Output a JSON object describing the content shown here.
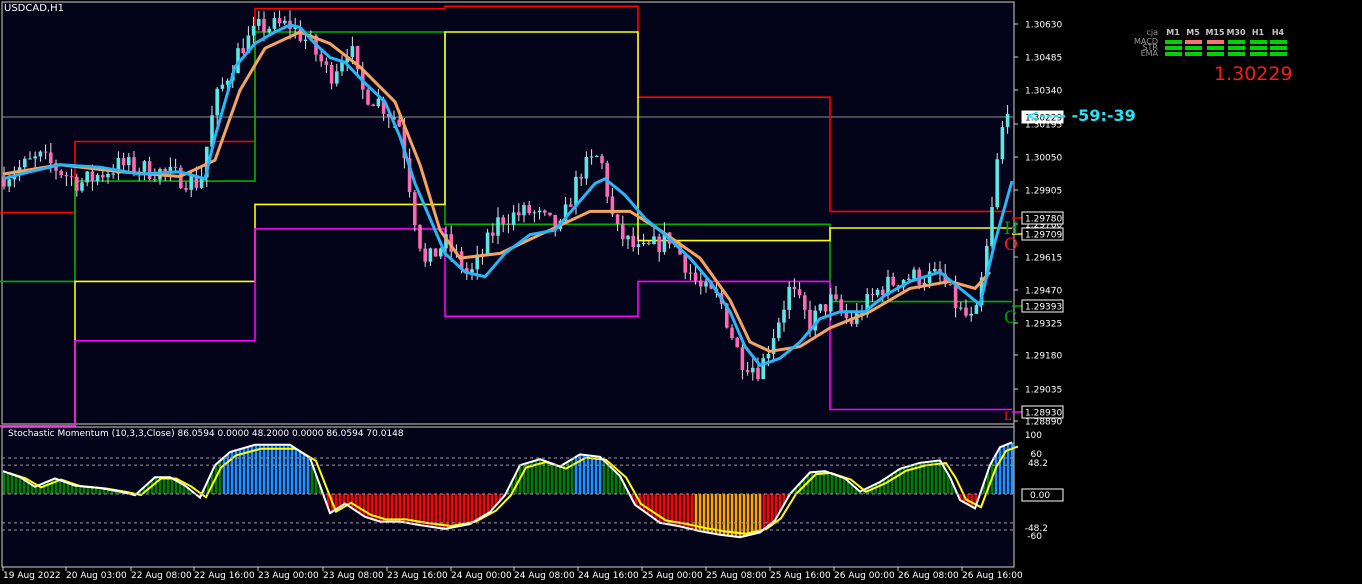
{
  "window": {
    "symbol_title": "USDCAD,H1"
  },
  "indicator": {
    "title": "Stochastic Momentum (10,3,3,Close) 86.0594 0.0000 48.2000 0.0000 86.0594 70.0148",
    "levels": [
      "100",
      "60",
      "48.2",
      "0.00",
      "-48.2",
      "-60"
    ],
    "zero_box": "0.00"
  },
  "signal_panel": {
    "pair_code": "cja",
    "timeframes": [
      "M1",
      "M5",
      "M15",
      "M30",
      "H1",
      "H4"
    ],
    "rows": [
      {
        "label": "MACD",
        "cells": [
          "#00d400",
          "#ff6f6f",
          "#ff6f6f",
          "#00d400",
          "#00d400",
          "#00d400"
        ]
      },
      {
        "label": "STR",
        "cells": [
          "#00d400",
          "#00d400",
          "#00d400",
          "#00d400",
          "#00d400",
          "#00d400"
        ]
      },
      {
        "label": "EMA",
        "cells": [
          "#00d400",
          "#00d400",
          "#00d400",
          "#00d400",
          "#00d400",
          "#00d400"
        ]
      }
    ]
  },
  "current_price": "1.30229",
  "countdown": "<---- -59:-39",
  "level_tags": {
    "high": "H",
    "open": "O",
    "close": "C",
    "low": "L"
  },
  "price_axis": {
    "ticks": [
      "1.30630",
      "1.30485",
      "1.30340",
      "1.30195",
      "1.30050",
      "1.29905",
      "1.29760",
      "1.29615",
      "1.29470",
      "1.29325",
      "1.29180",
      "1.29035",
      "1.28890"
    ],
    "boxes": [
      "1.30229",
      "1.29780",
      "1.29709",
      "1.29393",
      "1.28930"
    ]
  },
  "time_axis": {
    "labels": [
      "19 Aug 2022",
      "20 Aug 03:00",
      "22 Aug 08:00",
      "22 Aug 16:00",
      "23 Aug 00:00",
      "23 Aug 08:00",
      "23 Aug 16:00",
      "24 Aug 00:00",
      "24 Aug 08:00",
      "24 Aug 16:00",
      "25 Aug 00:00",
      "25 Aug 08:00",
      "25 Aug 16:00",
      "26 Aug 00:00",
      "26 Aug 08:00",
      "26 Aug 16:00"
    ]
  },
  "colors": {
    "background": "#000000",
    "chart_bg": "#03041a",
    "bull_candle": "#5ce6e6",
    "bear_candle": "#ff69b4",
    "fast_ma": "#29b6f6",
    "slow_ma": "#f4a460",
    "daily_high": "#ff0000",
    "daily_close": "#00b000",
    "daily_open": "#ffff00",
    "daily_low": "#ff00ff",
    "stoch_pos": "#008000",
    "stoch_neg": "#ff0000",
    "stoch_ext_pos": "#1e90ff",
    "stoch_ext_neg": "#ffa500",
    "stoch_main": "#ffffff",
    "stoch_signal": "#ffff00"
  },
  "chart_data": {
    "type": "candlestick",
    "price_range": [
      1.28868,
      1.3067
    ],
    "daily_levels": [
      {
        "from": 0,
        "to": 75,
        "high": 1.29775,
        "low": 1.2886,
        "open": 1.2886,
        "close": 1.2948
      },
      {
        "from": 75,
        "to": 255,
        "high": 1.3008,
        "low": 1.29225,
        "open": 1.2948,
        "close": 1.2991
      },
      {
        "from": 255,
        "to": 445,
        "high": 1.3065,
        "low": 1.29705,
        "open": 1.2981,
        "close": 1.3055
      },
      {
        "from": 445,
        "to": 638,
        "high": 1.3066,
        "low": 1.2933,
        "open": 1.3055,
        "close": 1.29725
      },
      {
        "from": 638,
        "to": 830,
        "high": 1.3027,
        "low": 1.2948,
        "open": 1.29655,
        "close": 1.29725
      },
      {
        "from": 830,
        "to": 1012,
        "high": 1.2978,
        "low": 1.2893,
        "open": 1.29709,
        "close": 1.29393
      }
    ],
    "close_path": [
      [
        3,
        1.2993
      ],
      [
        40,
        1.3001
      ],
      [
        80,
        1.299
      ],
      [
        120,
        1.2998
      ],
      [
        160,
        1.2995
      ],
      [
        200,
        1.299
      ],
      [
        215,
        1.3025
      ],
      [
        240,
        1.3048
      ],
      [
        260,
        1.3057
      ],
      [
        290,
        1.3058
      ],
      [
        310,
        1.305
      ],
      [
        330,
        1.3036
      ],
      [
        350,
        1.305
      ],
      [
        360,
        1.303
      ],
      [
        380,
        1.3025
      ],
      [
        400,
        1.3015
      ],
      [
        415,
        1.2975
      ],
      [
        425,
        1.2955
      ],
      [
        445,
        1.2965
      ],
      [
        470,
        1.295
      ],
      [
        500,
        1.2975
      ],
      [
        530,
        1.2978
      ],
      [
        560,
        1.297
      ],
      [
        580,
        1.2995
      ],
      [
        600,
        1.3002
      ],
      [
        615,
        1.297
      ],
      [
        640,
        1.296
      ],
      [
        670,
        1.2967
      ],
      [
        700,
        1.2945
      ],
      [
        720,
        1.294
      ],
      [
        740,
        1.2915
      ],
      [
        760,
        1.291
      ],
      [
        790,
        1.2945
      ],
      [
        810,
        1.293
      ],
      [
        830,
        1.294
      ],
      [
        850,
        1.293
      ],
      [
        880,
        1.2945
      ],
      [
        905,
        1.295
      ],
      [
        940,
        1.295
      ],
      [
        960,
        1.2935
      ],
      [
        975,
        1.293
      ],
      [
        990,
        1.297
      ],
      [
        1000,
        1.301
      ],
      [
        1010,
        1.30229
      ]
    ],
    "fast_ma": [
      [
        3,
        1.2992
      ],
      [
        30,
        1.2995
      ],
      [
        60,
        1.2998
      ],
      [
        100,
        1.2997
      ],
      [
        140,
        1.2994
      ],
      [
        180,
        1.2995
      ],
      [
        205,
        1.2992
      ],
      [
        215,
        1.301
      ],
      [
        235,
        1.304
      ],
      [
        255,
        1.305
      ],
      [
        275,
        1.3055
      ],
      [
        290,
        1.3058
      ],
      [
        300,
        1.3057
      ],
      [
        315,
        1.305
      ],
      [
        330,
        1.3044
      ],
      [
        345,
        1.3042
      ],
      [
        365,
        1.3033
      ],
      [
        385,
        1.3025
      ],
      [
        400,
        1.301
      ],
      [
        415,
        1.299
      ],
      [
        430,
        1.2975
      ],
      [
        445,
        1.296
      ],
      [
        465,
        1.2952
      ],
      [
        485,
        1.295
      ],
      [
        505,
        1.296
      ],
      [
        530,
        1.2968
      ],
      [
        555,
        1.297
      ],
      [
        575,
        1.298
      ],
      [
        595,
        1.299
      ],
      [
        605,
        1.2992
      ],
      [
        625,
        1.2985
      ],
      [
        645,
        1.2975
      ],
      [
        665,
        1.2968
      ],
      [
        690,
        1.2958
      ],
      [
        710,
        1.2948
      ],
      [
        730,
        1.2935
      ],
      [
        745,
        1.292
      ],
      [
        760,
        1.2912
      ],
      [
        780,
        1.2915
      ],
      [
        800,
        1.2922
      ],
      [
        820,
        1.2932
      ],
      [
        840,
        1.2935
      ],
      [
        865,
        1.2935
      ],
      [
        885,
        1.2942
      ],
      [
        910,
        1.2948
      ],
      [
        940,
        1.2952
      ],
      [
        960,
        1.2945
      ],
      [
        980,
        1.2938
      ],
      [
        995,
        1.2965
      ],
      [
        1012,
        1.2991
      ]
    ],
    "slow_ma": [
      [
        3,
        1.2994
      ],
      [
        60,
        1.2998
      ],
      [
        120,
        1.2995
      ],
      [
        180,
        1.2993
      ],
      [
        215,
        1.3
      ],
      [
        240,
        1.303
      ],
      [
        265,
        1.3048
      ],
      [
        300,
        1.3055
      ],
      [
        330,
        1.305
      ],
      [
        360,
        1.304
      ],
      [
        395,
        1.3025
      ],
      [
        420,
        1.2998
      ],
      [
        440,
        1.297
      ],
      [
        460,
        1.2958
      ],
      [
        500,
        1.296
      ],
      [
        540,
        1.2968
      ],
      [
        590,
        1.2978
      ],
      [
        630,
        1.2978
      ],
      [
        660,
        1.297
      ],
      [
        700,
        1.2958
      ],
      [
        730,
        1.294
      ],
      [
        750,
        1.2922
      ],
      [
        770,
        1.2918
      ],
      [
        800,
        1.292
      ],
      [
        830,
        1.2928
      ],
      [
        870,
        1.2935
      ],
      [
        910,
        1.2945
      ],
      [
        950,
        1.2948
      ],
      [
        975,
        1.2945
      ],
      [
        990,
        1.2952
      ]
    ],
    "stoch_path": [
      [
        3,
        38
      ],
      [
        20,
        28
      ],
      [
        35,
        12
      ],
      [
        55,
        26
      ],
      [
        75,
        14
      ],
      [
        100,
        10
      ],
      [
        120,
        4
      ],
      [
        135,
        -2
      ],
      [
        155,
        28
      ],
      [
        170,
        28
      ],
      [
        185,
        14
      ],
      [
        200,
        -6
      ],
      [
        215,
        48
      ],
      [
        230,
        70
      ],
      [
        255,
        82
      ],
      [
        290,
        82
      ],
      [
        310,
        60
      ],
      [
        330,
        -32
      ],
      [
        345,
        -16
      ],
      [
        365,
        -38
      ],
      [
        380,
        -46
      ],
      [
        400,
        -46
      ],
      [
        420,
        -52
      ],
      [
        445,
        -58
      ],
      [
        470,
        -50
      ],
      [
        490,
        -30
      ],
      [
        505,
        -2
      ],
      [
        520,
        48
      ],
      [
        540,
        58
      ],
      [
        560,
        46
      ],
      [
        580,
        66
      ],
      [
        600,
        62
      ],
      [
        620,
        30
      ],
      [
        635,
        -18
      ],
      [
        660,
        -48
      ],
      [
        680,
        -54
      ],
      [
        700,
        -62
      ],
      [
        720,
        -68
      ],
      [
        740,
        -72
      ],
      [
        760,
        -64
      ],
      [
        775,
        -44
      ],
      [
        790,
        0
      ],
      [
        810,
        36
      ],
      [
        825,
        38
      ],
      [
        845,
        26
      ],
      [
        860,
        4
      ],
      [
        880,
        20
      ],
      [
        900,
        42
      ],
      [
        920,
        52
      ],
      [
        940,
        56
      ],
      [
        950,
        28
      ],
      [
        960,
        -10
      ],
      [
        975,
        -24
      ],
      [
        990,
        48
      ],
      [
        1000,
        78
      ],
      [
        1012,
        86
      ]
    ]
  }
}
